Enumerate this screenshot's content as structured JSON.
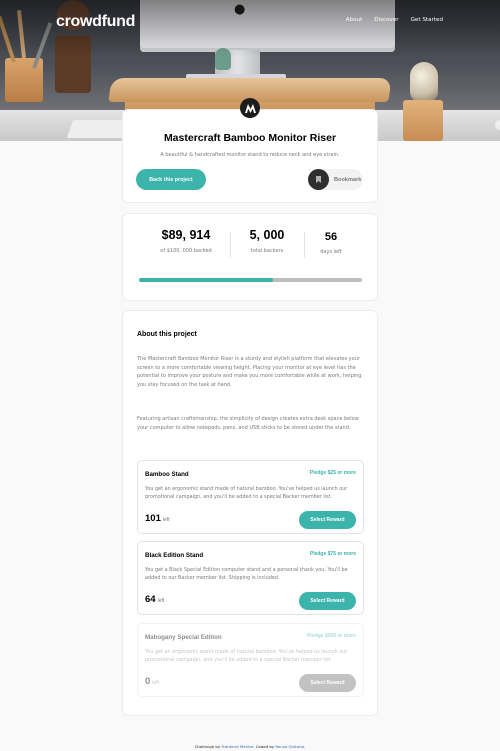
{
  "brand": {
    "logo_text": "crowdfund"
  },
  "nav": {
    "items": [
      "About",
      "Discover",
      "Get Started"
    ]
  },
  "project": {
    "title": "Mastercraft Bamboo Monitor Riser",
    "description": "A beautiful & handcrafted monitor stand to reduce neck and eye strain.",
    "back_label": "Back this project",
    "bookmark_label": "Bookmark",
    "logo_icon": "mastercraft-logo-icon",
    "bookmark_icon": "bookmark-icon"
  },
  "stats": {
    "backed": {
      "value": "$89, 914",
      "label": "of $100, 000 backed"
    },
    "backers": {
      "value": "5, 000",
      "label": "total backers"
    },
    "days": {
      "value": "56",
      "label": "days left"
    },
    "progress_fraction": 0.6
  },
  "about": {
    "title": "About this project",
    "paragraphs": [
      "The Mastercraft Bamboo Monitor Riser is a sturdy and stylish platform that elevates your screen to a more comfortable viewing height. Placing your monitor at eye level has the potential to improve your posture and make you more comfortable while at work, helping you stay focused on the task at hand.",
      "Featuring artisan craftsmanship, the simplicity of design creates extra desk space below your computer to allow notepads, pens, and USB sticks to be stored under the stand."
    ]
  },
  "pledges": [
    {
      "name": "Bamboo Stand",
      "amount": "Pledge $25 or more",
      "description": "You get an ergonomic stand made of natural bamboo. You've helped us launch our promotional campaign, and you'll be added to a special Backer member list.",
      "count": "101",
      "left_label": "left",
      "button": "Select Reward"
    },
    {
      "name": "Black Edition Stand",
      "amount": "Pledge $75 or more",
      "description": "You get a Black Special Edition computer stand and a personal thank you. You'll be added to our Backer member list. Shipping is included.",
      "count": "64",
      "left_label": "left",
      "button": "Select Reward"
    },
    {
      "name": "Mahogany Special Edition",
      "amount": "Pledge $200 or more",
      "description": "You get an ergonomic stand made of natural bamboo. You've helped us launch our promotional campaign, and you'll be added to a special Backer member list.",
      "count": "0",
      "left_label": "left",
      "button": "Select Reward"
    }
  ],
  "footer": {
    "prefix": "Challenge by",
    "challenge_link": "Frontend Mentor",
    "middle": ". Coded by",
    "author_link": "Renzo Quitaria",
    "suffix": "."
  },
  "colors": {
    "accent": "#3cb4ac",
    "dark_accent": "#147a73",
    "muted": "#7a7a7a"
  }
}
